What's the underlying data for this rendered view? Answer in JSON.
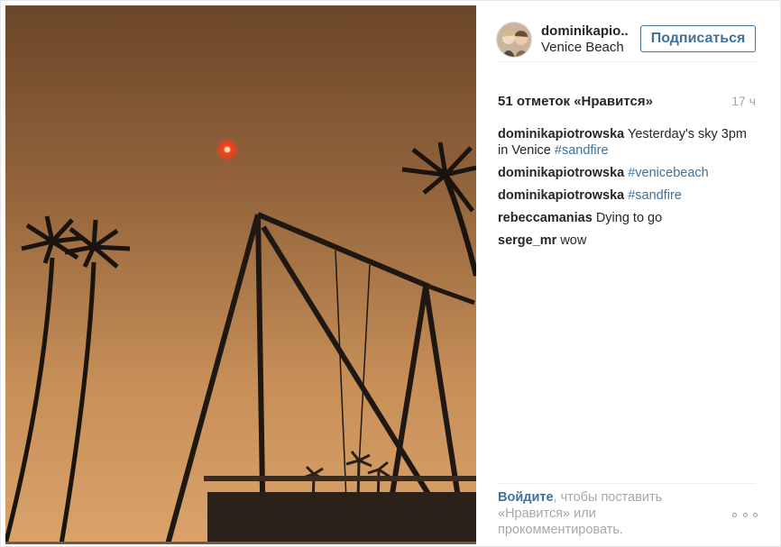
{
  "header": {
    "username": "dominikapio..",
    "location": "Venice Beach",
    "follow_label": "Подписаться"
  },
  "meta": {
    "likes": "51 отметок «Нравится»",
    "time": "17 ч"
  },
  "comments": [
    {
      "author": "dominikapiotrowska",
      "text": "Yesterday's sky 3pm in Venice ",
      "tag": "#sandfire"
    },
    {
      "author": "dominikapiotrowska",
      "text": "",
      "tag": "#venicebeach"
    },
    {
      "author": "dominikapiotrowska",
      "text": "",
      "tag": "#sandfire"
    },
    {
      "author": "rebeccamanias",
      "text": "Dying to go",
      "tag": ""
    },
    {
      "author": "serge_mr",
      "text": "wow",
      "tag": ""
    }
  ],
  "footer": {
    "login_link": "Войдите",
    "login_rest": ", чтобы поставить «Нравится» или прокомментировать."
  },
  "colors": {
    "link": "#3f729b",
    "sky_top": "#6e4a2c",
    "sky_bottom": "#d49c62",
    "sun": "#ff3b1a"
  },
  "icons": {
    "more": "ellipsis-icon"
  }
}
